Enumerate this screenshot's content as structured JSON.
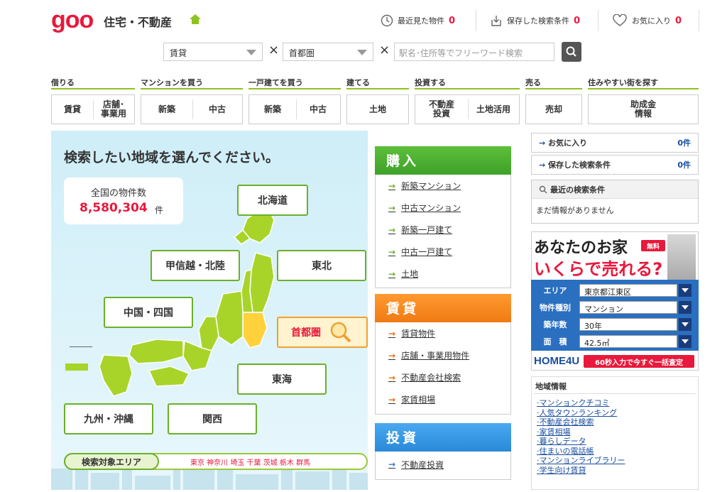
{
  "header": {
    "logo": "goo",
    "logo_sub": "住宅・不動産",
    "recent_label": "最近見た物件",
    "recent_count": "0",
    "saved_label": "保存した検索条件",
    "saved_count": "0",
    "fav_label": "お気に入り",
    "fav_count": "0"
  },
  "search": {
    "type_value": "賃貸",
    "area_value": "首都圏",
    "x1": "×",
    "x2": "×",
    "placeholder": "駅名･住所等でフリーワード検索"
  },
  "nav": {
    "categories": [
      "借りる",
      "マンションを買う",
      "一戸建てを買う",
      "建てる",
      "投資する",
      "売る",
      "住みやすい街を探す"
    ],
    "rent": "賃貸",
    "store_line1": "店舗･",
    "store_line2": "事業用",
    "mansion_new": "新築",
    "mansion_used": "中古",
    "house_new": "新築",
    "house_used": "中古",
    "land": "土地",
    "invest_line1": "不動産",
    "invest_line2": "投資",
    "land_use": "土地活用",
    "sell": "売却",
    "subsidy_line1": "助成金",
    "subsidy_line2": "情報"
  },
  "map": {
    "title": "検索したい地域を選んでください。",
    "count_label": "全国の物件数",
    "count_value": "8,580,304",
    "count_unit": "件",
    "regions": {
      "hokkaido": "北海道",
      "koshinetsu": "甲信越・北陸",
      "tohoku": "東北",
      "chugoku": "中国・四国",
      "shutoken": "首都圏",
      "tokai": "東海",
      "kyushu": "九州・沖縄",
      "kansai": "関西"
    },
    "area_badge": "検索対象エリア",
    "area_list": "東京 神奈川 埼玉 千葉 茨城 栃木 群馬"
  },
  "buy": {
    "title": "購入",
    "items": [
      "新築マンション",
      "中古マンション",
      "新築一戸建て",
      "中古一戸建て",
      "土地"
    ]
  },
  "rent": {
    "title": "賃貸",
    "items": [
      "賃貸物件",
      "店舗・事業用物件",
      "不動産会社検索",
      "家賃相場"
    ]
  },
  "invest": {
    "title": "投資",
    "items": [
      "不動産投資"
    ]
  },
  "side": {
    "fav_label": "お気に入り",
    "fav_count": "0件",
    "saved_label": "保存した検索条件",
    "saved_count": "0件",
    "recent_search_label": "最近の検索条件",
    "recent_search_empty": "まだ情報がありません"
  },
  "ad": {
    "line1": "あなたのお家",
    "free": "無料",
    "line2": "いくらで売れる?",
    "area_label": "エリア",
    "area_value": "東京都江東区",
    "type_label": "物件種別",
    "type_value": "マンション",
    "age_label": "築年数",
    "age_value": "30年",
    "size_label": "面　積",
    "size_value": "42.5㎡",
    "logo": "HOME4U",
    "cta": "60秒入力で今すぐ一括査定"
  },
  "info": {
    "head": "地域情報",
    "items": [
      "マンションクチコミ",
      "人気タウンランキング",
      "不動産会社検索",
      "家賃相場",
      "暮らしデータ",
      "住まいの電話帳",
      "マンションライブラリー",
      "学生向け賃貸"
    ]
  },
  "colors": {
    "brand_red": "#e8193c",
    "buy_green": "#3ea12a",
    "rent_orange": "#f07a14",
    "invest_blue": "#2a8ad8"
  }
}
